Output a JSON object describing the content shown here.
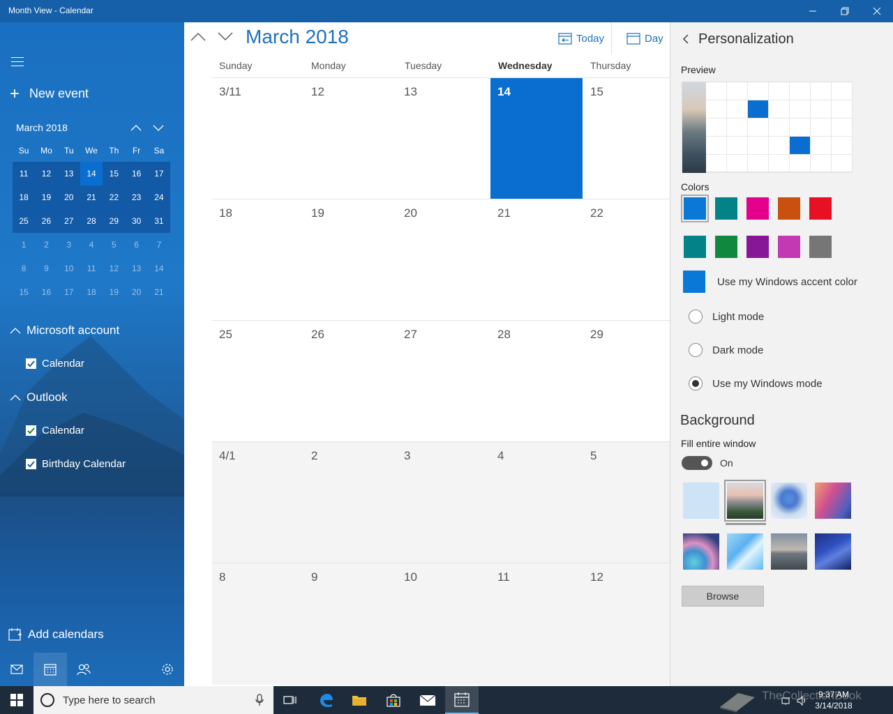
{
  "window": {
    "title": "Month View - Calendar"
  },
  "sidebar": {
    "new_event_label": "New event",
    "mini_calendar": {
      "month_label": "March 2018",
      "dow": [
        "Su",
        "Mo",
        "Tu",
        "We",
        "Th",
        "Fr",
        "Sa"
      ],
      "rows": [
        [
          "11",
          "12",
          "13",
          "14",
          "15",
          "16",
          "17"
        ],
        [
          "18",
          "19",
          "20",
          "21",
          "22",
          "23",
          "24"
        ],
        [
          "25",
          "26",
          "27",
          "28",
          "29",
          "30",
          "31"
        ],
        [
          "1",
          "2",
          "3",
          "4",
          "5",
          "6",
          "7"
        ],
        [
          "8",
          "9",
          "10",
          "11",
          "12",
          "13",
          "14"
        ],
        [
          "15",
          "16",
          "17",
          "18",
          "19",
          "20",
          "21"
        ]
      ]
    },
    "accounts": [
      {
        "name": "Microsoft account",
        "calendars": [
          "Calendar"
        ]
      },
      {
        "name": "Outlook",
        "calendars": [
          "Calendar",
          "Birthday Calendar"
        ]
      }
    ],
    "add_calendars_label": "Add calendars"
  },
  "main": {
    "month_title": "March 2018",
    "today_label": "Today",
    "day_label": "Day",
    "weekdays": [
      "Sunday",
      "Monday",
      "Tuesday",
      "Wednesday",
      "Thursday"
    ],
    "weeks": [
      [
        "3/11",
        "12",
        "13",
        "14",
        "15"
      ],
      [
        "18",
        "19",
        "20",
        "21",
        "22"
      ],
      [
        "25",
        "26",
        "27",
        "28",
        "29"
      ],
      [
        "4/1",
        "2",
        "3",
        "4",
        "5"
      ],
      [
        "8",
        "9",
        "10",
        "11",
        "12"
      ]
    ]
  },
  "personalization": {
    "title": "Personalization",
    "preview_label": "Preview",
    "colors_label": "Colors",
    "colors_row1": [
      "#0a78d7",
      "#038387",
      "#e3008c",
      "#ca5010",
      "#e81123"
    ],
    "colors_row2": [
      "#038387",
      "#10893e",
      "#881798",
      "#c239b3",
      "#767676"
    ],
    "accent_color": "#0a78d7",
    "use_accent_label": "Use my Windows accent color",
    "modes": [
      "Light mode",
      "Dark mode",
      "Use my Windows mode"
    ],
    "background_label": "Background",
    "fill_label": "Fill entire window",
    "toggle_label": "On",
    "browse_label": "Browse"
  },
  "taskbar": {
    "search_placeholder": "Type here to search",
    "time": "9:37 AM",
    "date": "3/14/2018",
    "watermark": "TheCollectionBook"
  }
}
